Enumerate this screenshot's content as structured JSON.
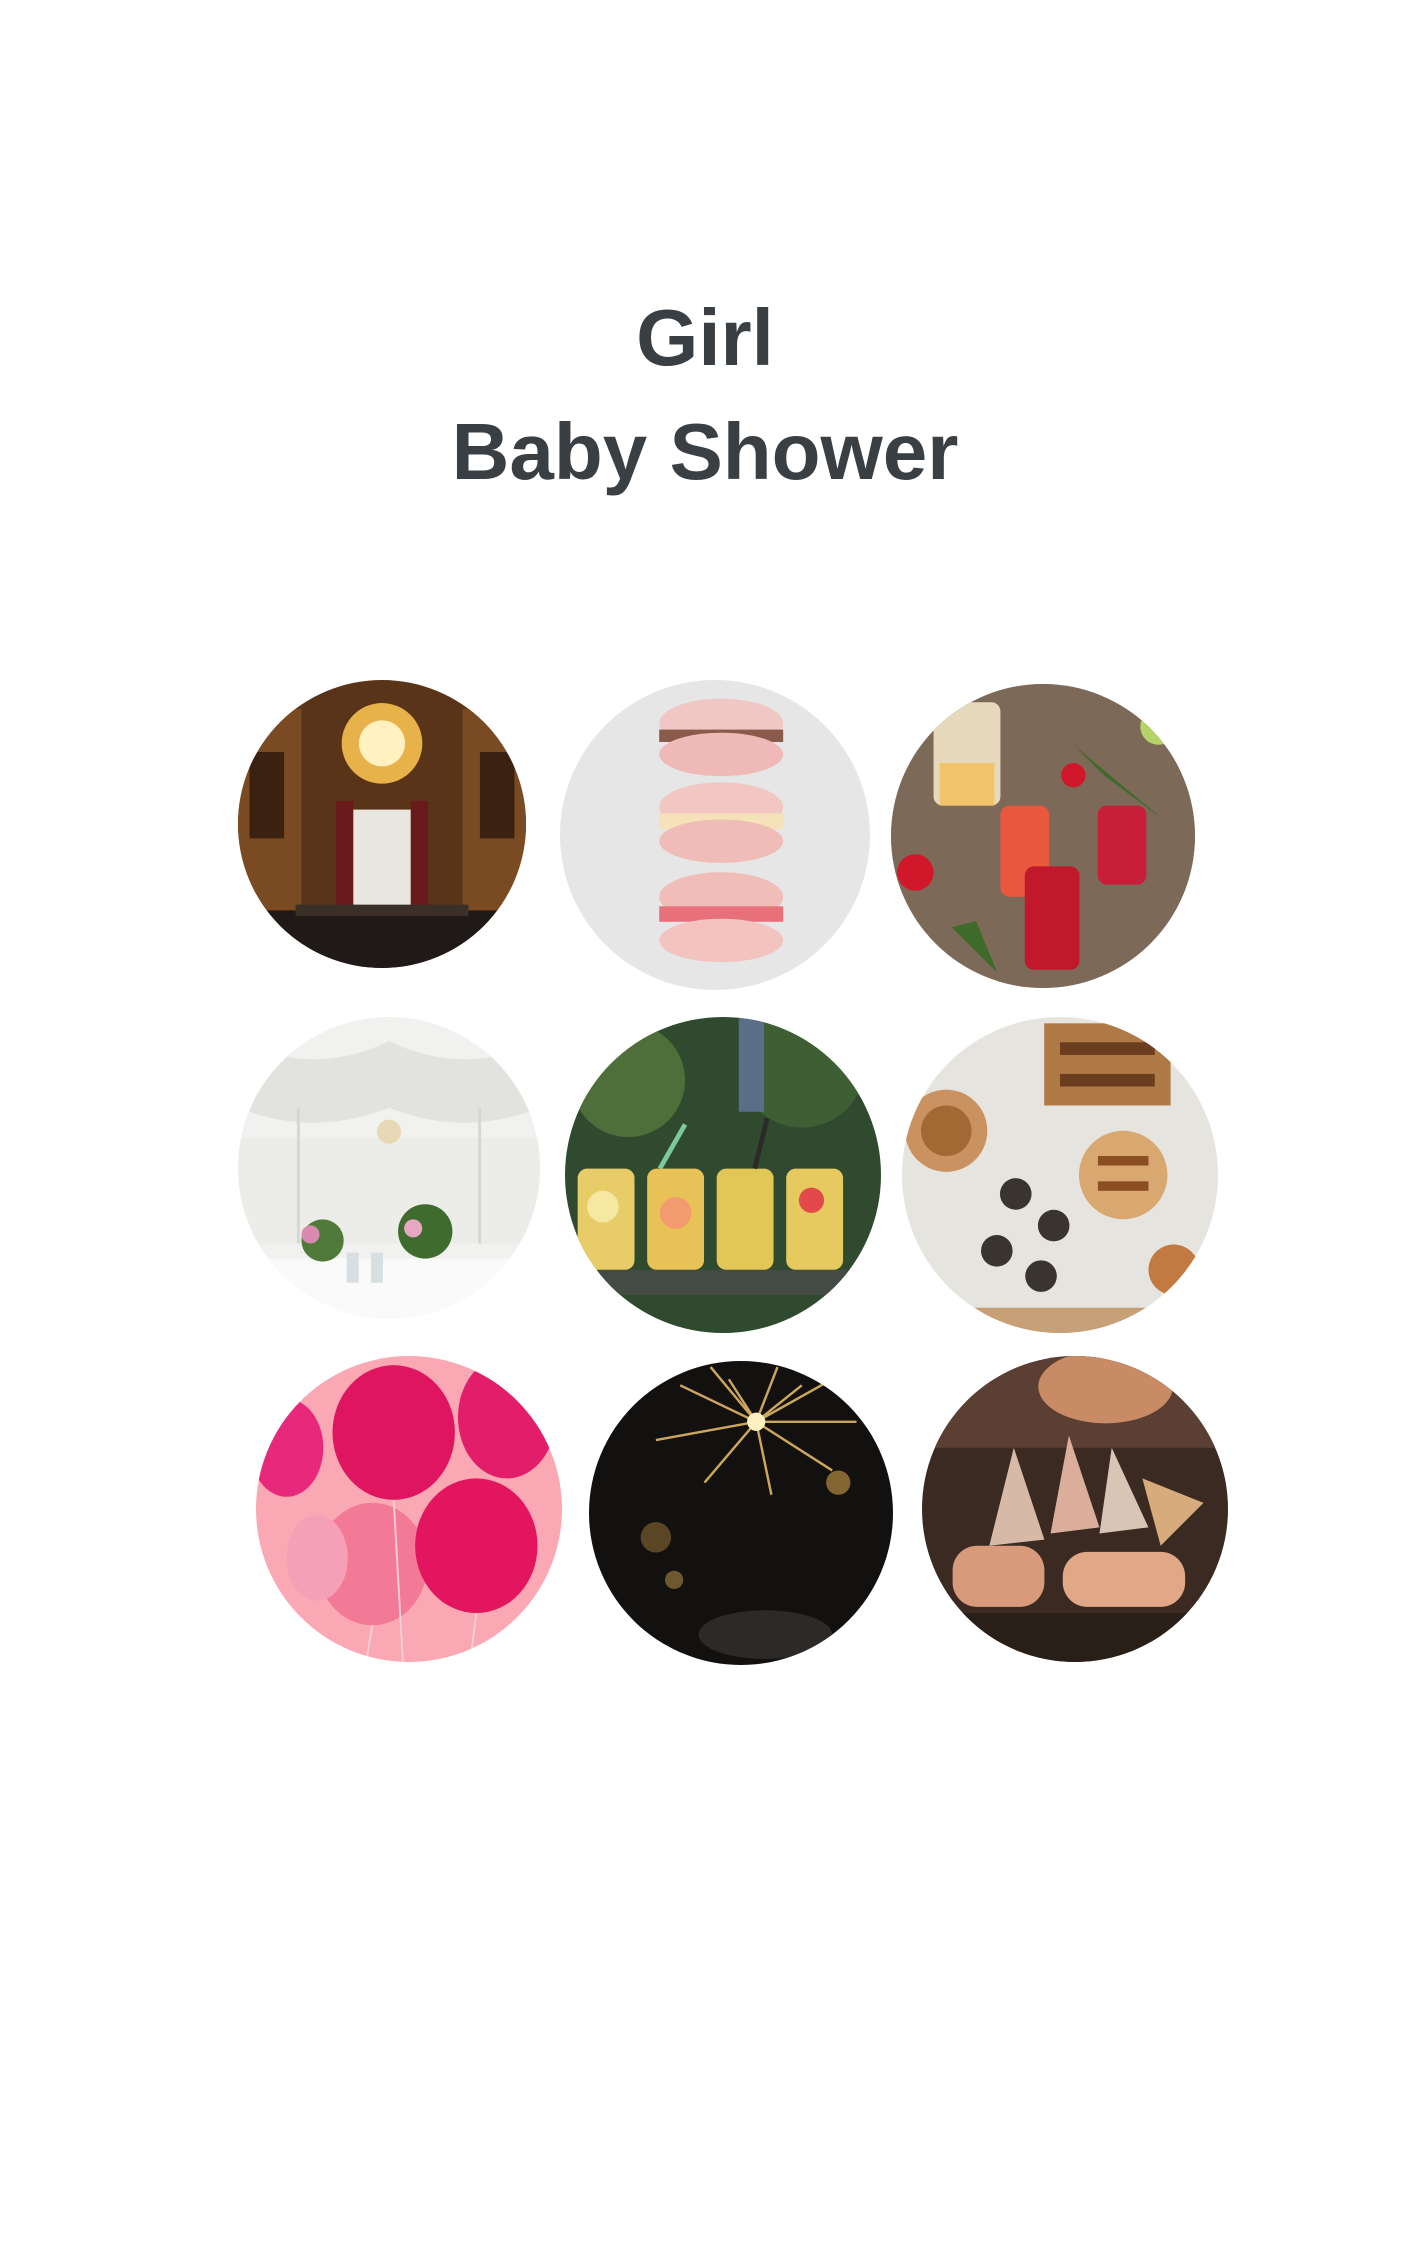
{
  "title": {
    "line1": "Girl",
    "line2": "Baby Shower"
  },
  "colors": {
    "title_text": "#3a3f44",
    "background": "#ffffff"
  },
  "photos": [
    {
      "subject": "chandelier-ballroom"
    },
    {
      "subject": "macaron-stack"
    },
    {
      "subject": "berry-cocktails"
    },
    {
      "subject": "tent-table-setting"
    },
    {
      "subject": "lemonade-jars"
    },
    {
      "subject": "snack-platter"
    },
    {
      "subject": "pink-balloons"
    },
    {
      "subject": "fireworks"
    },
    {
      "subject": "toasting-glasses"
    }
  ]
}
